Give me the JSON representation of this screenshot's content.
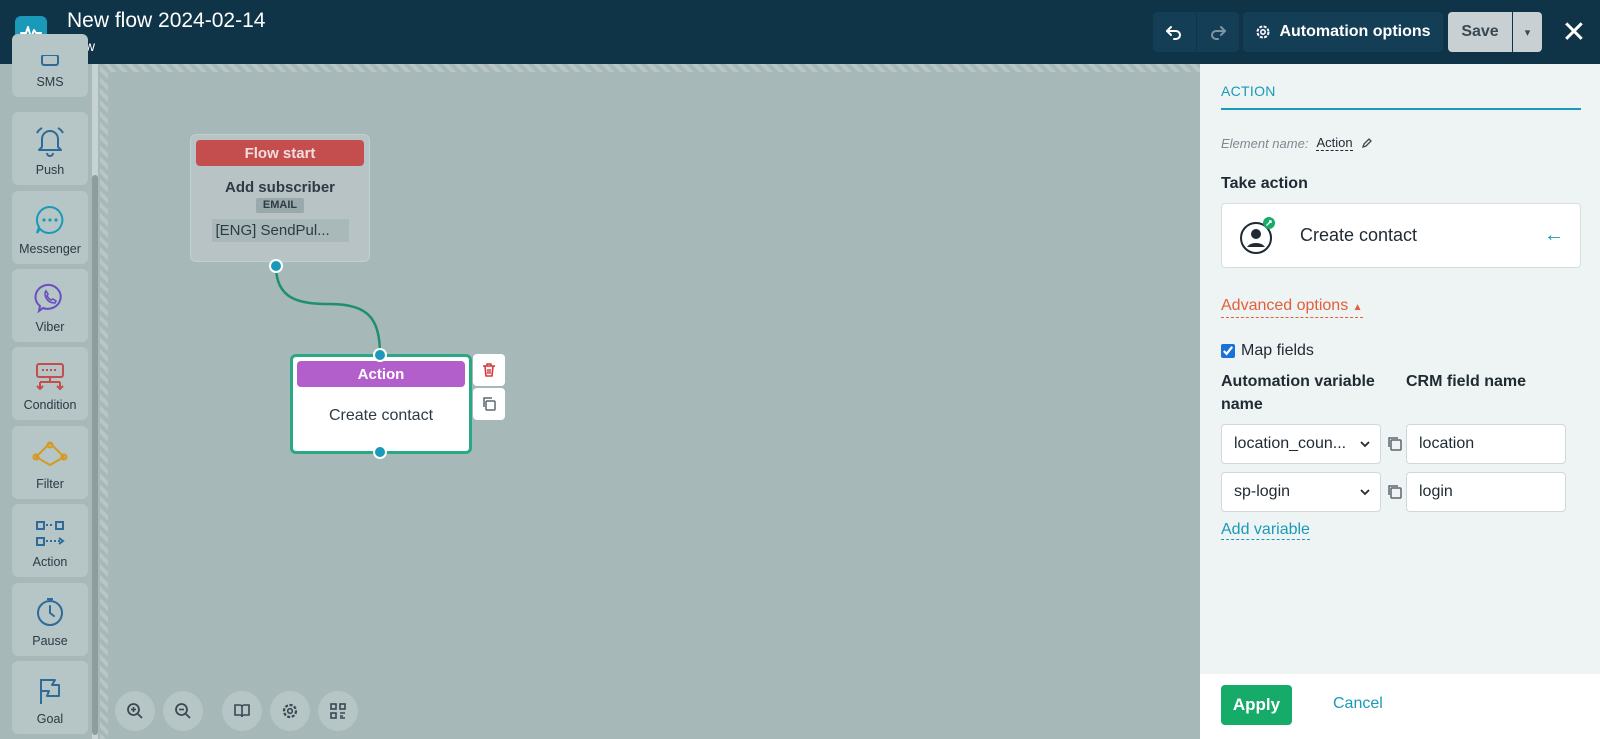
{
  "header": {
    "title": "New flow 2024-02-14",
    "status": "New",
    "automation_options_label": "Automation options",
    "save_label": "Save"
  },
  "sidebar": {
    "items": [
      {
        "label": "SMS",
        "icon": "sms-icon"
      },
      {
        "label": "Push",
        "icon": "bell-icon"
      },
      {
        "label": "Messenger",
        "icon": "chat-icon"
      },
      {
        "label": "Viber",
        "icon": "viber-icon"
      },
      {
        "label": "Condition",
        "icon": "condition-icon"
      },
      {
        "label": "Filter",
        "icon": "filter-icon"
      },
      {
        "label": "Action",
        "icon": "action-icon"
      },
      {
        "label": "Pause",
        "icon": "clock-icon"
      },
      {
        "label": "Goal",
        "icon": "flag-icon"
      }
    ]
  },
  "canvas": {
    "start_node": {
      "header": "Flow start",
      "title": "Add subscriber",
      "tag": "EMAIL",
      "list": "[ENG] SendPul..."
    },
    "action_node": {
      "header": "Action",
      "body": "Create contact"
    }
  },
  "panel": {
    "tab": "ACTION",
    "element_name_label": "Element name:",
    "element_name_value": "Action",
    "take_action_label": "Take action",
    "action_card_label": "Create contact",
    "advanced_label": "Advanced options",
    "map_fields_label": "Map fields",
    "map_fields_checked": true,
    "col_variable_label": "Automation variable name",
    "col_crm_label": "CRM field name",
    "rows": [
      {
        "variable": "location_coun...",
        "crm_field": "location"
      },
      {
        "variable": "sp-login",
        "crm_field": "login"
      }
    ],
    "add_variable_label": "Add variable",
    "apply_label": "Apply",
    "cancel_label": "Cancel"
  },
  "colors": {
    "header_bg": "#0f3347",
    "accent": "#1a9ab8",
    "start_header": "#c44d4d",
    "action_header": "#b35fcb",
    "selected_border": "#2aa886",
    "apply": "#17ab6a",
    "advanced": "#e0603c"
  }
}
